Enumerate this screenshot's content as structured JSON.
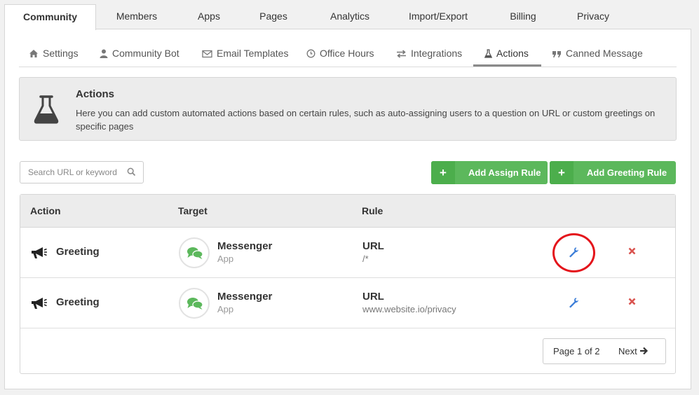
{
  "top_tabs": [
    "Community",
    "Members",
    "Apps",
    "Pages",
    "Analytics",
    "Import/Export",
    "Billing",
    "Privacy"
  ],
  "active_top_tab": "Community",
  "sub_tabs": [
    {
      "label": "Settings",
      "icon": "home-icon"
    },
    {
      "label": "Community Bot",
      "icon": "user-icon"
    },
    {
      "label": "Email Templates",
      "icon": "envelope-icon"
    },
    {
      "label": "Office Hours",
      "icon": "clock-icon"
    },
    {
      "label": "Integrations",
      "icon": "exchange-icon"
    },
    {
      "label": "Actions",
      "icon": "flask-icon"
    },
    {
      "label": "Canned Message",
      "icon": "quote-icon"
    }
  ],
  "active_sub_tab": "Actions",
  "info": {
    "title": "Actions",
    "text": "Here you can add custom automated actions based on certain rules, such as auto-assigning users to a question on URL or custom greetings on specific pages"
  },
  "search": {
    "placeholder": "Search URL or keyword",
    "value": ""
  },
  "buttons": {
    "add_assign_rule": "Add Assign Rule",
    "add_greeting_rule": "Add Greeting Rule",
    "plus": "+"
  },
  "table": {
    "headers": {
      "action": "Action",
      "target": "Target",
      "rule": "Rule"
    },
    "rows": [
      {
        "action": "Greeting",
        "target_name": "Messenger",
        "target_type": "App",
        "rule_type": "URL",
        "rule_value": "/*"
      },
      {
        "action": "Greeting",
        "target_name": "Messenger",
        "target_type": "App",
        "rule_type": "URL",
        "rule_value": "www.website.io/privacy"
      }
    ]
  },
  "pagination": {
    "info": "Page 1 of 2",
    "next": "Next"
  },
  "colors": {
    "green": "#5cb85c",
    "edit_blue": "#3b7dd8",
    "delete_red": "#d9534f",
    "highlight": "#e4141b"
  }
}
